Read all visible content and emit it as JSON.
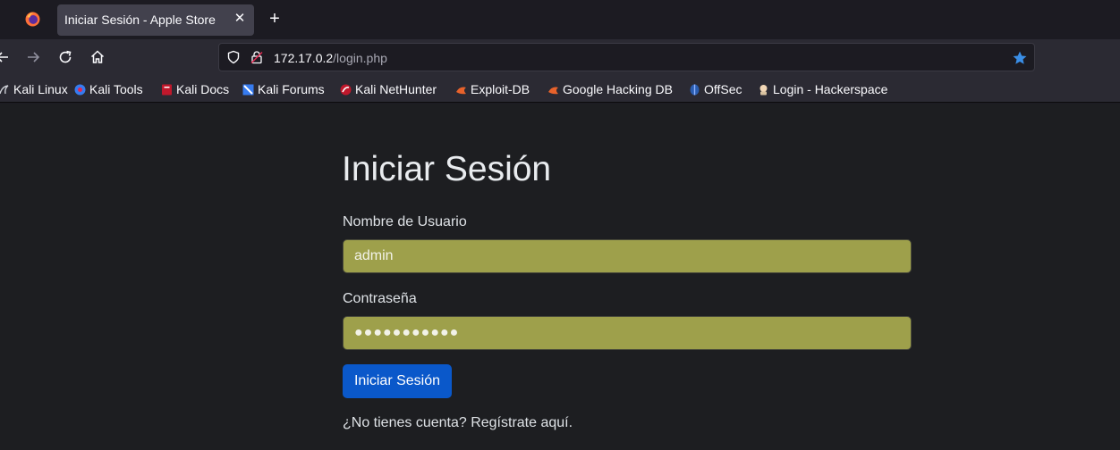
{
  "browser": {
    "tab": {
      "title": "Iniciar Sesión - Apple Store",
      "close_glyph": "✕"
    },
    "new_tab_glyph": "+",
    "url": {
      "host": "172.17.0.2",
      "path": "/login.php"
    },
    "accent_color": "#3a8ee6"
  },
  "bookmarks": [
    {
      "label": "Kali Linux",
      "icon": "kali-dragon-icon"
    },
    {
      "label": "Kali Tools",
      "icon": "kali-tools-icon"
    },
    {
      "label": "Kali Docs",
      "icon": "kali-docs-icon"
    },
    {
      "label": "Kali Forums",
      "icon": "kali-forums-icon"
    },
    {
      "label": "Kali NetHunter",
      "icon": "kali-nethunter-icon"
    },
    {
      "label": "Exploit-DB",
      "icon": "exploit-db-icon"
    },
    {
      "label": "Google Hacking DB",
      "icon": "ghdb-icon"
    },
    {
      "label": "OffSec",
      "icon": "offsec-icon"
    },
    {
      "label": "Login - Hackerspace",
      "icon": "hackerspace-icon"
    }
  ],
  "login": {
    "title": "Iniciar Sesión",
    "username_label": "Nombre de Usuario",
    "username_value": "admin",
    "password_label": "Contraseña",
    "password_value": "●●●●●●●●●●●",
    "submit_label": "Iniciar Sesión",
    "register_text": "¿No tienes cuenta? Regístrate aquí.",
    "field_color": "#9ea04b",
    "button_color": "#0a58ca"
  }
}
